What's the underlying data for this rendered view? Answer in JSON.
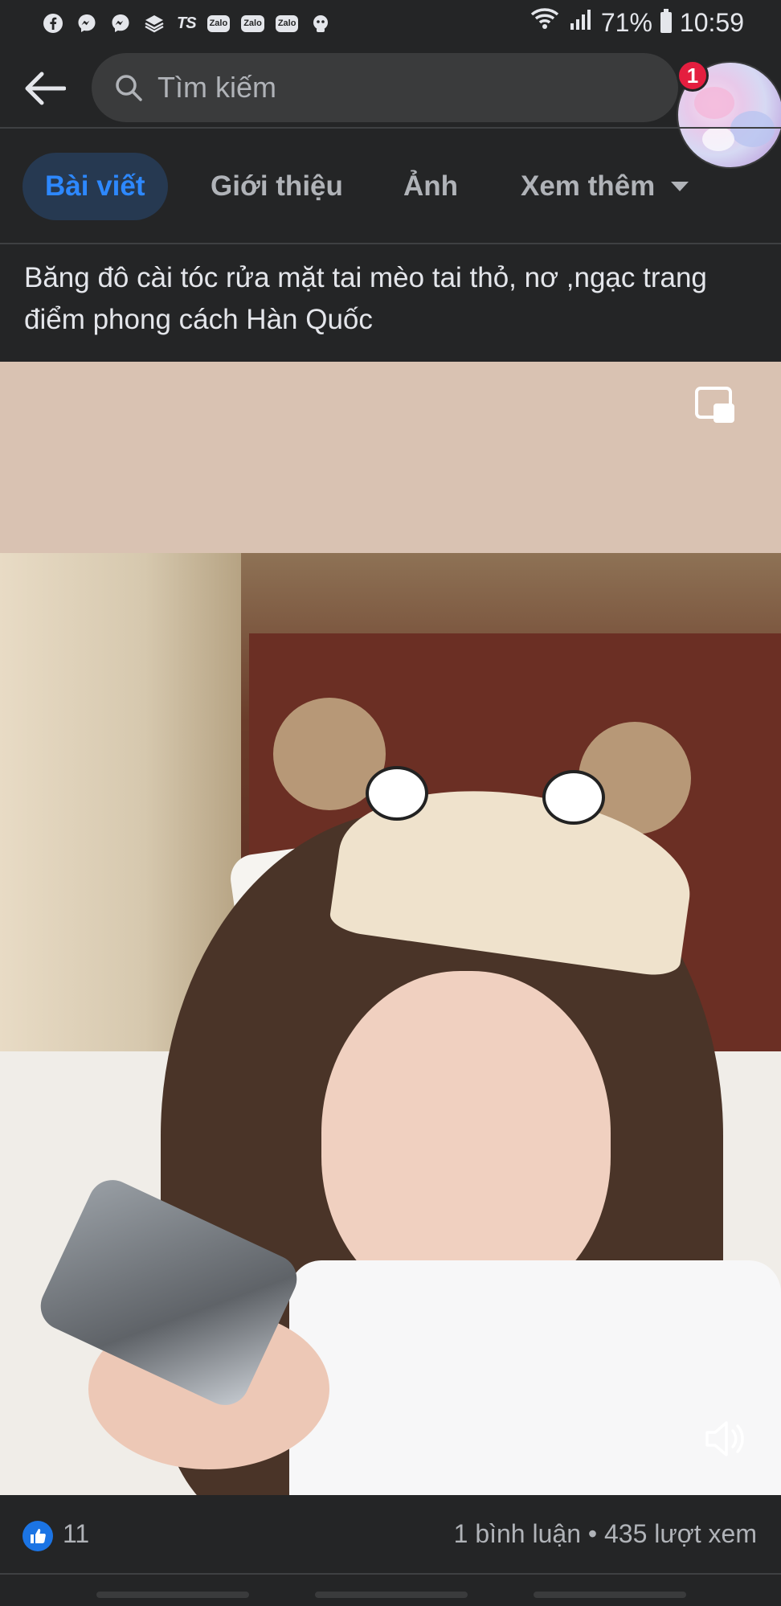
{
  "status_bar": {
    "battery": "71%",
    "time": "10:59",
    "notification_icons": [
      "facebook-icon",
      "messenger-icon",
      "messenger-icon",
      "layers-icon",
      "ts-icon",
      "zalo-icon",
      "zalo-icon",
      "zalo-icon",
      "android-icon"
    ],
    "zalo_label": "Zalo",
    "ts_label": "TS"
  },
  "topbar": {
    "search_placeholder": "Tìm kiếm",
    "notification_count": "1"
  },
  "tabs": [
    {
      "label": "Bài viết",
      "active": true
    },
    {
      "label": "Giới thiệu",
      "active": false
    },
    {
      "label": "Ảnh",
      "active": false
    },
    {
      "label": "Xem thêm",
      "active": false
    }
  ],
  "post": {
    "caption": "Băng đô cài tóc rửa mặt tai mèo tai thỏ, nơ ,ngạc trang điểm phong cách Hàn Quốc",
    "like_count": "11",
    "stats": "1 bình luận • 435 lượt xem"
  },
  "colors": {
    "background": "#242526",
    "accent": "#2d88ff",
    "search_bg": "#3a3b3c",
    "badge": "#e41e3f"
  }
}
